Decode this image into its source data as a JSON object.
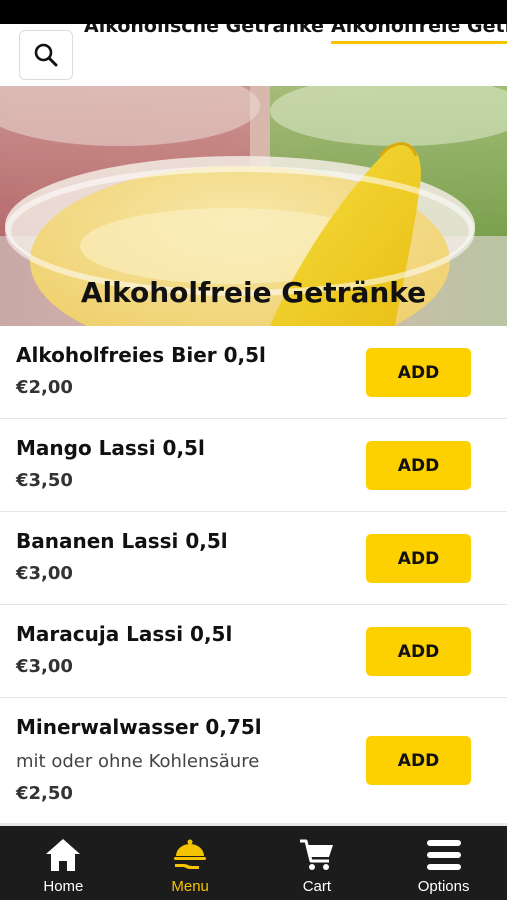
{
  "header": {
    "category_tabs": [
      "Alkoholische Getränke",
      "Alkoholfreie Getränke"
    ],
    "active_tab_index": 1,
    "accent_color": "#f5c400",
    "search_icon": "search-icon"
  },
  "hero": {
    "title": "Alkoholfreie Getränke"
  },
  "items": [
    {
      "name": "Alkoholfreies Bier 0,5l",
      "price": "€2,00",
      "button": "ADD"
    },
    {
      "name": "Mango Lassi 0,5l",
      "price": "€3,50",
      "button": "ADD"
    },
    {
      "name": "Bananen Lassi 0,5l",
      "price": "€3,00",
      "button": "ADD"
    },
    {
      "name": "Maracuja Lassi 0,5l",
      "price": "€3,00",
      "button": "ADD"
    },
    {
      "name": "Minerwalwasser 0,75l",
      "description": "mit oder ohne Kohlensäure",
      "price": "€2,50",
      "button": "ADD"
    }
  ],
  "nav": {
    "items": [
      {
        "label": "Home",
        "icon": "home-icon"
      },
      {
        "label": "Menu",
        "icon": "food-tray-icon",
        "active": true
      },
      {
        "label": "Cart",
        "icon": "cart-icon"
      },
      {
        "label": "Options",
        "icon": "menu-bars-icon"
      }
    ],
    "active_color": "#f5c400"
  },
  "colors": {
    "button": "#fdd000",
    "nav_background": "#1c1c1c"
  }
}
